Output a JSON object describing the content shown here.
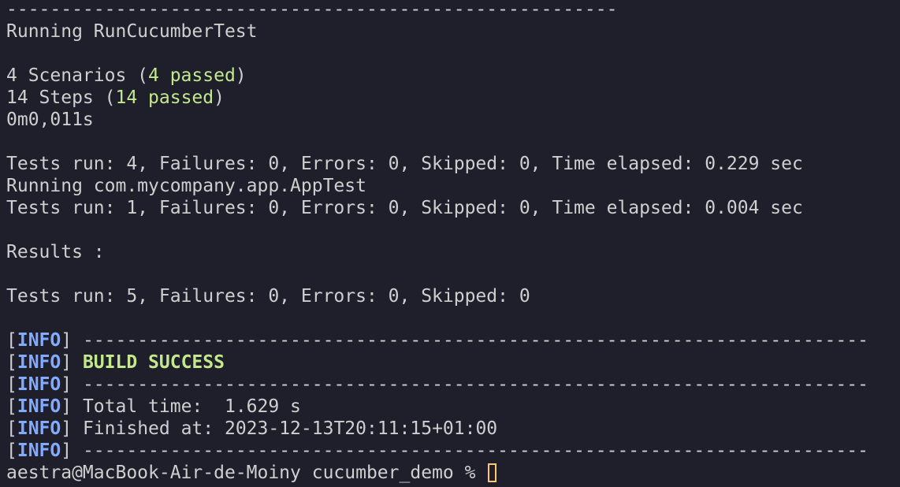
{
  "lines": {
    "sep_top": "--------------------------------------------------------",
    "running1": "Running RunCucumberTest",
    "scenarios_pre": "4 Scenarios (",
    "scenarios_passed": "4 passed",
    "steps_pre": "14 Steps (",
    "steps_passed": "14 passed",
    "close_paren": ")",
    "duration": "0m0,011s",
    "tests1": "Tests run: 4, Failures: 0, Errors: 0, Skipped: 0, Time elapsed: 0.229 sec",
    "running2": "Running com.mycompany.app.AppTest",
    "tests2": "Tests run: 1, Failures: 0, Errors: 0, Skipped: 0, Time elapsed: 0.004 sec",
    "results": "Results :",
    "tests_total": "Tests run: 5, Failures: 0, Errors: 0, Skipped: 0"
  },
  "maven": {
    "bracket_open": "[",
    "tag": "INFO",
    "bracket_close": "] ",
    "separator": "------------------------------------------------------------------------",
    "build_success": "BUILD SUCCESS",
    "total_time": "Total time:  1.629 s",
    "finished_at": "Finished at: 2023-12-13T20:11:15+01:00"
  },
  "prompt": {
    "text": "aestra@MacBook-Air-de-Moiny cucumber_demo % "
  },
  "colors": {
    "background": "#1e1f2b",
    "text": "#cfcfcf",
    "success": "#c3e88d",
    "info": "#82aaff",
    "cursor": "#ffc66d"
  }
}
